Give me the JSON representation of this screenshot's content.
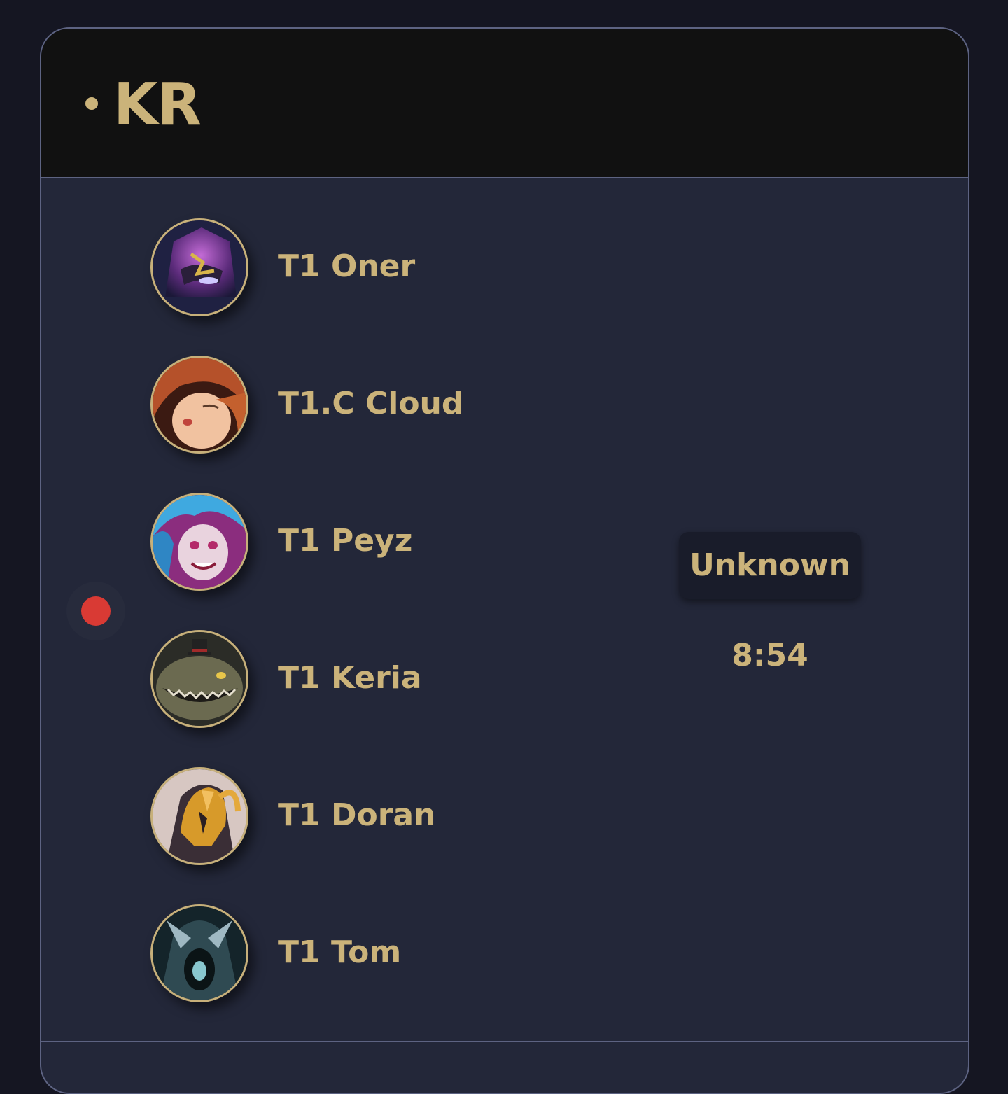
{
  "region": {
    "title": "KR"
  },
  "players": [
    {
      "name": "T1 Oner",
      "avatar_icon": "champion-avatar-icon"
    },
    {
      "name": "T1.C Cloud",
      "avatar_icon": "champion-avatar-icon"
    },
    {
      "name": "T1 Peyz",
      "avatar_icon": "champion-avatar-icon"
    },
    {
      "name": "T1 Keria",
      "avatar_icon": "champion-avatar-icon"
    },
    {
      "name": "T1 Doran",
      "avatar_icon": "champion-avatar-icon"
    },
    {
      "name": "T1 Tom",
      "avatar_icon": "champion-avatar-icon"
    }
  ],
  "game": {
    "status": "Unknown",
    "timer": "8:54"
  },
  "colors": {
    "accent": "#cbb37a",
    "live": "#d93a34",
    "panel": "#232739",
    "header": "#111111",
    "border": "#5d6382"
  }
}
